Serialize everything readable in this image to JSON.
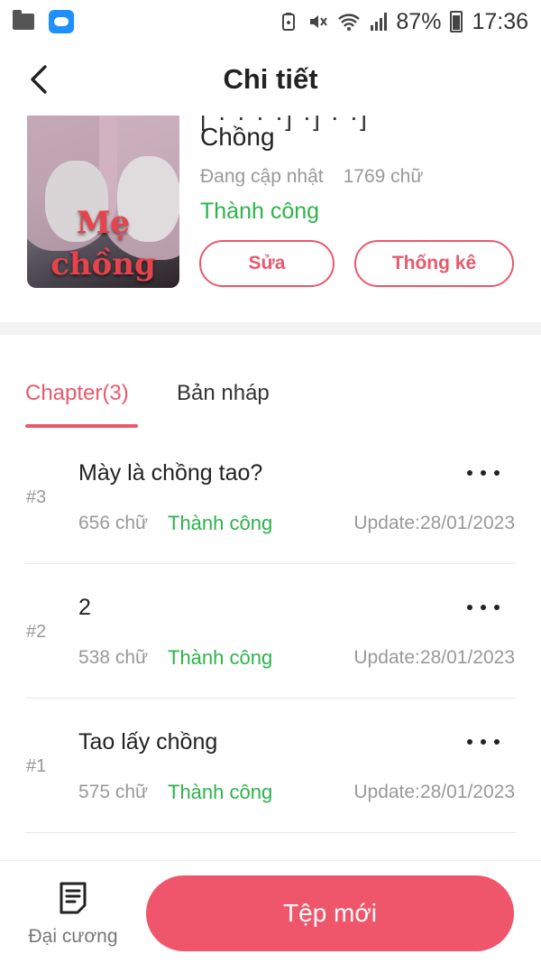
{
  "status_bar": {
    "battery": "87%",
    "time": "17:36",
    "icons": [
      "folder-icon",
      "cloud-upload-icon",
      "battery-saver-icon",
      "mute-icon",
      "wifi-icon",
      "signal-icon",
      "battery-icon"
    ]
  },
  "header": {
    "title": "Chi tiết",
    "back_icon": "chevron-left-icon"
  },
  "book": {
    "title_cut": "[ · · · ·] ·] · ·]",
    "title": "Chồng",
    "cover_title_line1": "Mẹ",
    "cover_title_line2": "chồng",
    "update_status": "Đang cập nhật",
    "word_count": "1769 chữ",
    "review_status": "Thành công",
    "edit_label": "Sửa",
    "stats_label": "Thống kê"
  },
  "tabs": {
    "chapter_label": "Chapter(3)",
    "draft_label": "Bản nháp"
  },
  "chapters": [
    {
      "number": "#3",
      "title": "Mày là chồng tao?",
      "words": "656 chữ",
      "status": "Thành công",
      "update": "Update:28/01/2023"
    },
    {
      "number": "#2",
      "title": "2",
      "words": "538 chữ",
      "status": "Thành công",
      "update": "Update:28/01/2023"
    },
    {
      "number": "#1",
      "title": "Tao lấy chồng",
      "words": "575 chữ",
      "status": "Thành công",
      "update": "Update:28/01/2023"
    }
  ],
  "bottom": {
    "outline_label": "Đại cương",
    "new_label": "Tệp mới"
  },
  "colors": {
    "accent": "#f0566b",
    "success": "#2db34a",
    "muted": "#999999"
  }
}
